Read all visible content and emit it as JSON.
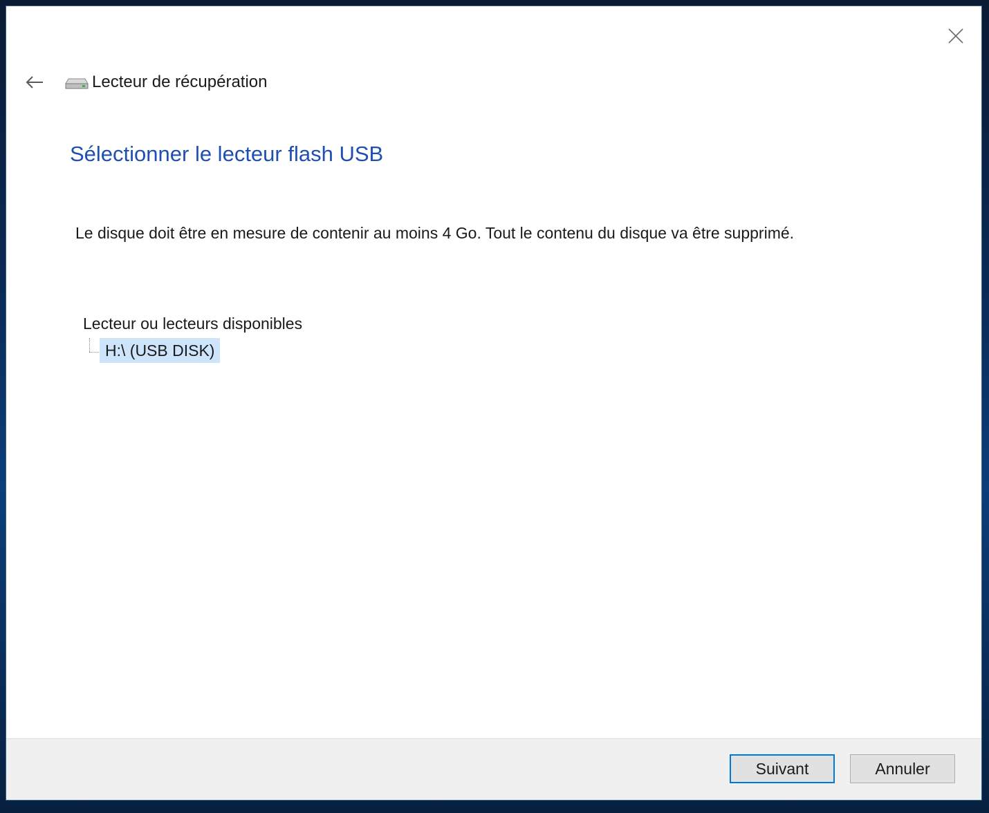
{
  "window": {
    "header_title": "Lecteur de récupération"
  },
  "main": {
    "page_title": "Sélectionner le lecteur flash USB",
    "description": "Le disque doit être en mesure de contenir au moins 4 Go. Tout le contenu du disque va être supprimé.",
    "drives_label": "Lecteur ou lecteurs disponibles",
    "drives": [
      {
        "label": "H:\\ (USB DISK)",
        "selected": true
      }
    ]
  },
  "footer": {
    "next_label": "Suivant",
    "cancel_label": "Annuler"
  },
  "colors": {
    "title_blue": "#1f4fb4",
    "selection": "#cde4fb",
    "default_button_border": "#0078d7"
  },
  "icons": {
    "close": "close-icon",
    "back": "back-arrow-icon",
    "drive": "drive-icon"
  }
}
